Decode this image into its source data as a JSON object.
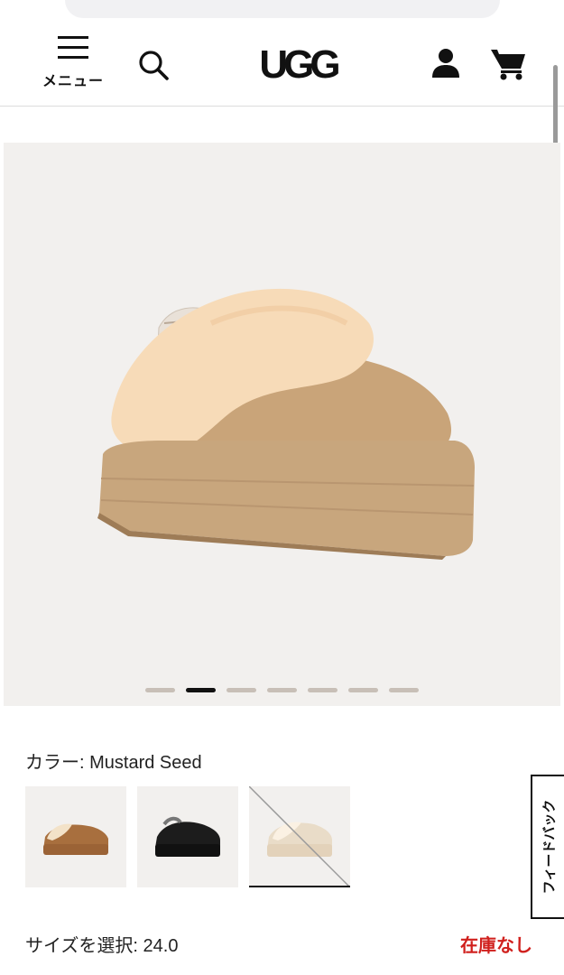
{
  "header": {
    "menu_label": "メニュー",
    "logo_text": "UGG"
  },
  "hero": {
    "image_count": 7,
    "active_index": 1,
    "dot_colors": {
      "active": "#111111",
      "inactive": "#c8bfb7"
    }
  },
  "product": {
    "color_label": "カラー: Mustard Seed",
    "swatches": [
      {
        "name": "Chestnut",
        "selected": false
      },
      {
        "name": "Black",
        "selected": false
      },
      {
        "name": "Mustard Seed",
        "selected": true,
        "crossed_out": true
      }
    ],
    "size_label": "サイズを選択: 24.0",
    "stock_status": "在庫なし",
    "stock_color": "#d0201d"
  },
  "feedback": {
    "label": "フィードバック"
  },
  "icons": [
    "hamburger-icon",
    "search-icon",
    "account-icon",
    "cart-icon"
  ]
}
